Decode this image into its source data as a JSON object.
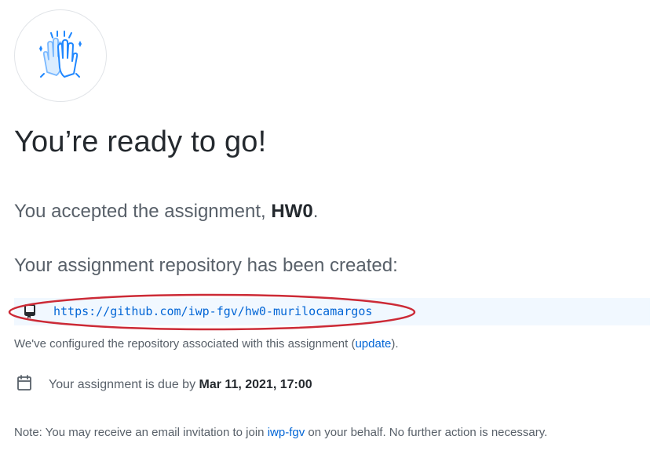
{
  "header": {
    "icon": "high-five-icon",
    "title": "You’re ready to go!"
  },
  "accepted": {
    "prefix": "You accepted the assignment, ",
    "assignment_name": "HW0",
    "suffix": "."
  },
  "repository": {
    "heading": "Your assignment repository has been created:",
    "icon": "repo-icon",
    "url": "https://github.com/iwp-fgv/hw0-murilocamargos"
  },
  "configured": {
    "text_before": "We've configured the repository associated with this assignment (",
    "link_label": "update",
    "text_after": ")."
  },
  "due": {
    "icon": "calendar-icon",
    "prefix": "Your assignment is due by ",
    "date": "Mar 11, 2021, 17:00"
  },
  "note": {
    "text_before": "Note: You may receive an email invitation to join ",
    "org_link": "iwp-fgv",
    "text_after": " on your behalf. No further action is necessary."
  },
  "colors": {
    "link": "#0366d6",
    "highlight_ellipse": "#cc2a36",
    "repo_box_bg": "#f1f8ff",
    "icon_blue": "#2188ff"
  }
}
